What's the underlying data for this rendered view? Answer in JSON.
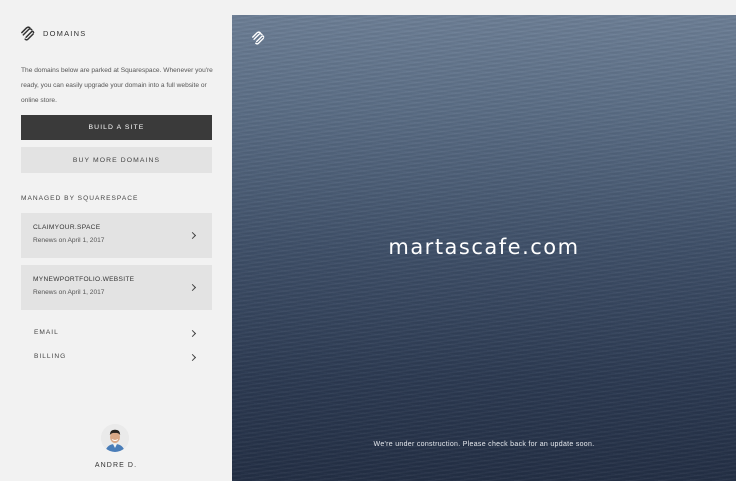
{
  "sidebar": {
    "title": "DOMAINS",
    "intro": "The domains below are parked at Squarespace. Whenever you're ready, you can easily upgrade your domain into a full website or online store.",
    "build_site_label": "BUILD A SITE",
    "buy_domains_label": "BUY MORE DOMAINS",
    "section_label": "MANAGED BY SQUARESPACE",
    "domains": [
      {
        "name": "CLAIMYOUR.SPACE",
        "renews": "Renews on April 1, 2017"
      },
      {
        "name": "MYNEWPORTFOLIO.WEBSITE",
        "renews": "Renews on April 1, 2017"
      }
    ],
    "links": [
      {
        "label": "EMAIL"
      },
      {
        "label": "BILLING"
      }
    ],
    "user": {
      "name": "ANDRE D."
    }
  },
  "preview": {
    "domain": "martascafe.com",
    "message": "We're under construction. Please check back for an update soon."
  },
  "icons": {
    "brand": "squarespace-logo-icon",
    "chevron": "chevron-right-icon"
  },
  "colors": {
    "sidebar_bg": "#f2f2f2",
    "primary_button": "#3a3a3a",
    "secondary_button": "#e3e3e3",
    "hero_top": "#6d7f96",
    "hero_bottom": "#232f45"
  }
}
